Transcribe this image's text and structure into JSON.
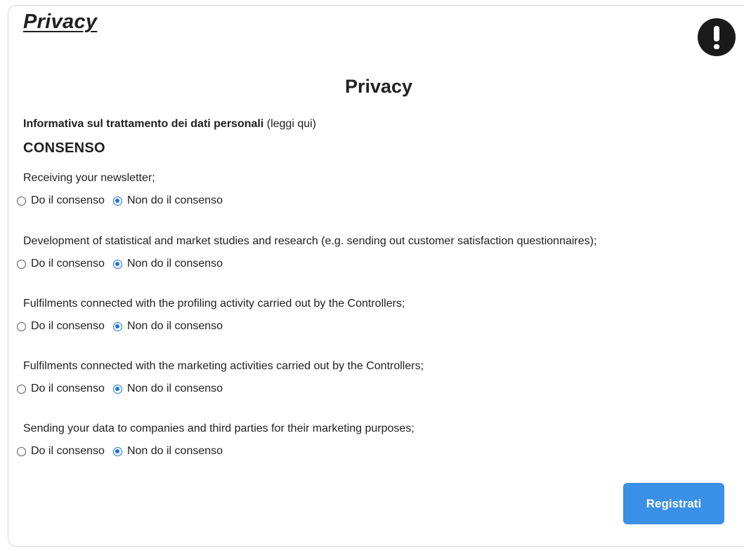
{
  "header": {
    "title": "Privacy",
    "alert_icon": "exclamation-icon"
  },
  "main": {
    "section_heading": "Privacy",
    "info_bold": "Informativa sul trattamento dei dati personali",
    "info_link": "(leggi qui)",
    "consent_heading": "CONSENSO",
    "consent_items": [
      {
        "question": "Receiving your newsletter;",
        "yes_label": "Do il consenso",
        "no_label": "Non do il consenso",
        "selected": "no"
      },
      {
        "question": "Development of statistical and market studies and research (e.g. sending out customer satisfaction questionnaires);",
        "yes_label": "Do il consenso",
        "no_label": "Non do il consenso",
        "selected": "no"
      },
      {
        "question": "Fulfilments connected with the profiling activity carried out by the Controllers;",
        "yes_label": "Do il consenso",
        "no_label": "Non do il consenso",
        "selected": "no"
      },
      {
        "question": "Fulfilments connected with the marketing activities carried out by the Controllers;",
        "yes_label": "Do il consenso",
        "no_label": "Non do il consenso",
        "selected": "no"
      },
      {
        "question": "Sending your data to companies and third parties for their marketing purposes;",
        "yes_label": "Do il consenso",
        "no_label": "Non do il consenso",
        "selected": "no"
      }
    ]
  },
  "footer": {
    "register_label": "Registrati"
  },
  "colors": {
    "accent": "#3a8fe6",
    "radio_selected": "#1a73e8",
    "border": "#d6d6d6"
  }
}
